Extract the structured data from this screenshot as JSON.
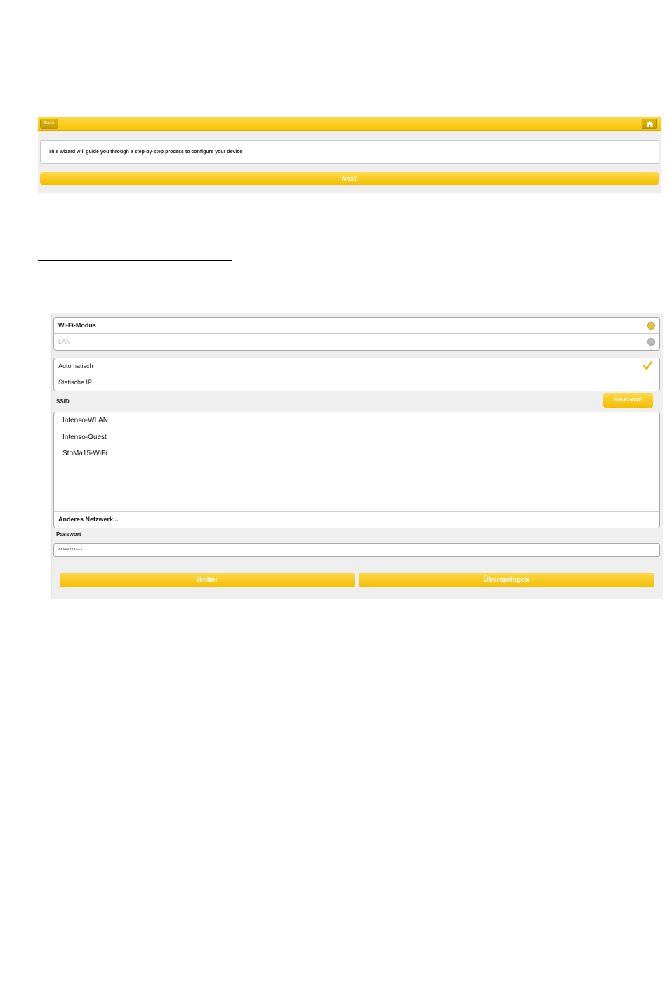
{
  "wizard": {
    "back_label": "Back",
    "home_icon": "home-icon",
    "info_text": "This wizard will guide you through a step-by-step process to configure your device",
    "next_label": "Next"
  },
  "network": {
    "mode_options": [
      {
        "label": "Wi-Fi-Modus",
        "selected": true
      },
      {
        "label": "LAN",
        "selected": false
      }
    ],
    "ip_options": [
      {
        "label": "Automatisch",
        "selected": true
      },
      {
        "label": "Statische IP",
        "selected": false
      }
    ],
    "ssid_label": "SSID",
    "scan_label": "Neuer Scan",
    "ssid_list": [
      "Intenso-WLAN",
      "Intenso-Guest",
      "StoMa15-WiFi",
      "",
      "",
      ""
    ],
    "other_network": "Anderes Netzwerk...",
    "password_label": "Passwort",
    "password_value": "***********",
    "continue_label": "Weiter",
    "skip_label": "Überspringen"
  },
  "colors": {
    "accent": "#f7c500",
    "active_dot": "#e2c146",
    "inactive_dot": "#b9b9b9",
    "check": "#f0b400"
  }
}
